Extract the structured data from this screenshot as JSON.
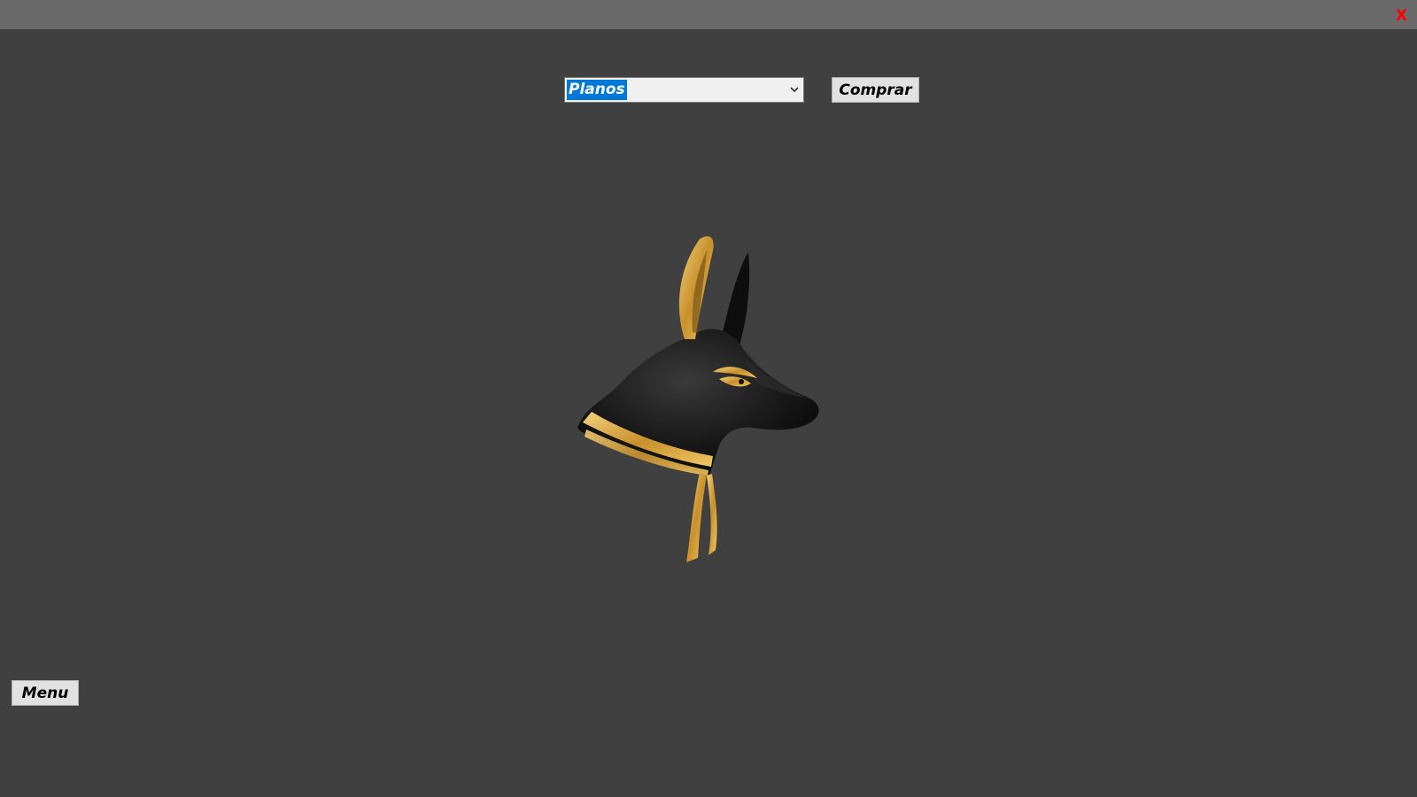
{
  "window": {
    "close_label": "X",
    "close_color": "#ff0000",
    "titlebar_color": "#6a6a6a",
    "background_color": "#404040"
  },
  "plans_select": {
    "value": "Planos",
    "selected_highlight": "#0078d7"
  },
  "buy_button": {
    "label": "Comprar"
  },
  "menu_button": {
    "label": "Menu"
  },
  "logo": {
    "icon": "anubis-head-icon",
    "colors": {
      "gold": "#d4a640",
      "black": "#151515"
    }
  }
}
